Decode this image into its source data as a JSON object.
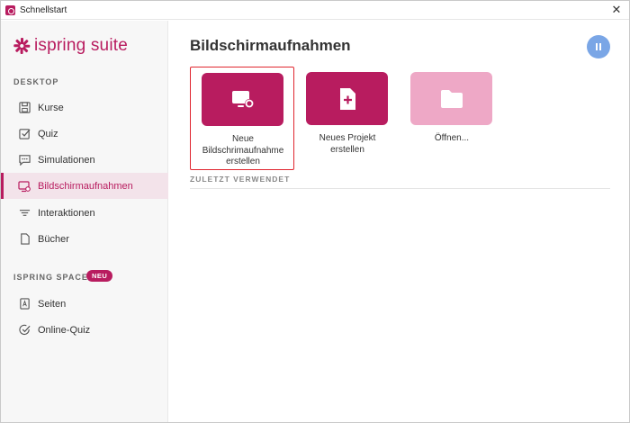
{
  "window": {
    "title": "Schnellstart",
    "close_glyph": "✕"
  },
  "logo": {
    "brand": "ispring suite"
  },
  "sidebar": {
    "desktop_label": "DESKTOP",
    "desktop_items": [
      {
        "label": "Kurse",
        "icon": "save-icon"
      },
      {
        "label": "Quiz",
        "icon": "checkbox-icon"
      },
      {
        "label": "Simulationen",
        "icon": "chat-icon"
      },
      {
        "label": "Bildschirmaufnahmen",
        "icon": "screen-record-icon",
        "active": true
      },
      {
        "label": "Interaktionen",
        "icon": "lines-icon"
      },
      {
        "label": "Bücher",
        "icon": "document-icon"
      }
    ],
    "space_label": "ISPRING SPACE",
    "space_badge": "NEU",
    "space_items": [
      {
        "label": "Seiten",
        "icon": "page-a-icon"
      },
      {
        "label": "Online-Quiz",
        "icon": "check-circle-icon"
      }
    ]
  },
  "main": {
    "title": "Bildschirmaufnahmen",
    "cards": [
      {
        "line1": "Neue",
        "line2": "Bildschrimaufnahme",
        "line3": "erstellen",
        "icon": "screen-record-icon"
      },
      {
        "line1": "Neues Projekt",
        "line2": "erstellen",
        "icon": "new-file-icon"
      },
      {
        "line1": "Öffnen...",
        "icon": "folder-icon"
      }
    ],
    "recent_label": "ZULETZT VERWENDET"
  },
  "colors": {
    "accent": "#b81c5f",
    "accent_light": "#eea8c6",
    "active_bg": "#f3e3ea",
    "avatar": "#7aa6e6",
    "highlight_border": "#e0262f"
  }
}
